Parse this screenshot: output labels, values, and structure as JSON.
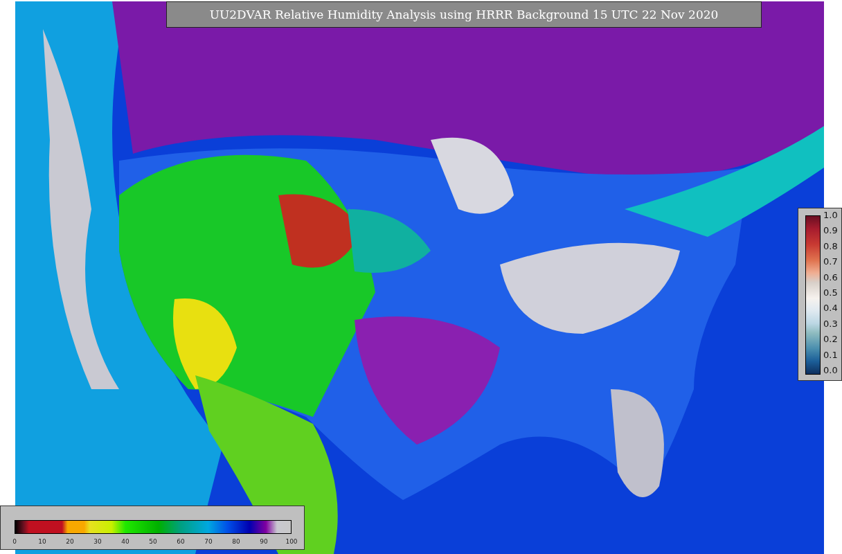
{
  "title": "UU2DVAR Relative Humidity Analysis using HRRR Background 15 UTC 22 Nov 2020",
  "right_colorbar": {
    "labels": [
      "1.0",
      "0.9",
      "0.8",
      "0.7",
      "0.6",
      "0.5",
      "0.4",
      "0.3",
      "0.2",
      "0.1",
      "0.0"
    ]
  },
  "bottom_colorbar": {
    "labels": [
      "0",
      "10",
      "20",
      "30",
      "40",
      "50",
      "60",
      "70",
      "80",
      "90",
      "100"
    ]
  }
}
